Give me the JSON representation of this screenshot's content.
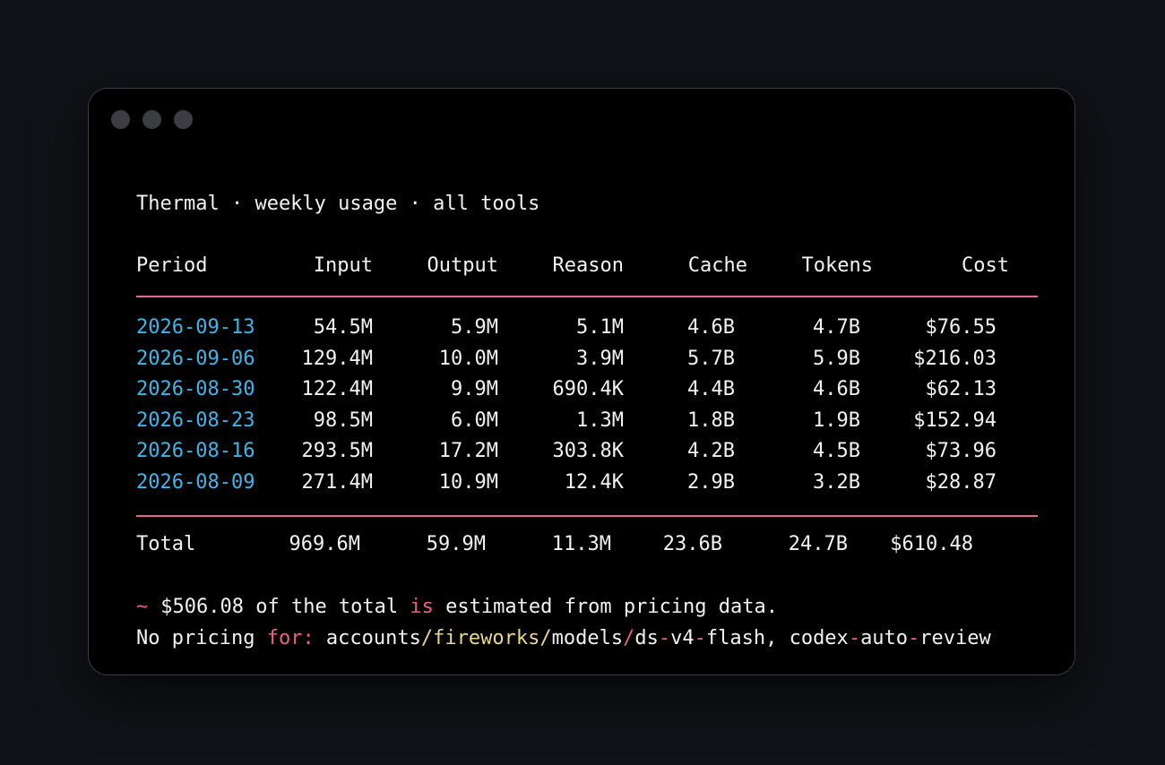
{
  "window": {
    "title": "Thermal · weekly usage · all tools"
  },
  "table": {
    "headers": [
      "Period",
      "Input",
      "Output",
      "Reason",
      "Cache",
      "Tokens",
      "Cost"
    ],
    "rows": [
      [
        "2026-09-13",
        "54.5M",
        "5.9M",
        "5.1M",
        "4.6B",
        "4.7B",
        "$76.55"
      ],
      [
        "2026-09-06",
        "129.4M",
        "10.0M",
        "3.9M",
        "5.7B",
        "5.9B",
        "$216.03"
      ],
      [
        "2026-08-30",
        "122.4M",
        "9.9M",
        "690.4K",
        "4.4B",
        "4.6B",
        "$62.13"
      ],
      [
        "2026-08-23",
        "98.5M",
        "6.0M",
        "1.3M",
        "1.8B",
        "1.9B",
        "$152.94"
      ],
      [
        "2026-08-16",
        "293.5M",
        "17.2M",
        "303.8K",
        "4.2B",
        "4.5B",
        "$73.96"
      ],
      [
        "2026-08-09",
        "271.4M",
        "10.9M",
        "12.4K",
        "2.9B",
        "3.2B",
        "$28.87"
      ]
    ],
    "total": [
      "Total",
      "969.6M",
      "59.9M",
      "11.3M",
      "23.6B",
      "24.7B",
      "$610.48"
    ]
  },
  "notes": {
    "tilde": "~",
    "estimate_amount": "$506.08",
    "estimate_mid1": " of the total ",
    "estimate_is": "is",
    "estimate_rest": " estimated from pricing data.",
    "no_pricing_label": "No pricing ",
    "no_pricing_for": "for:",
    "p1": " accounts",
    "p2": "/",
    "p3": "fireworks",
    "p4": "/",
    "p5": "models",
    "p6": "/",
    "p7": "ds",
    "p8": "-",
    "p9": "v4",
    "p10": "-",
    "p11": "flash, codex",
    "p12": "-",
    "p13": "auto",
    "p14": "-",
    "p15": "review"
  },
  "colors": {
    "date": "#3eb6e8",
    "rule": "#e5678f",
    "accent_pink": "#ec5f87",
    "accent_yellow": "#e9d88c"
  }
}
